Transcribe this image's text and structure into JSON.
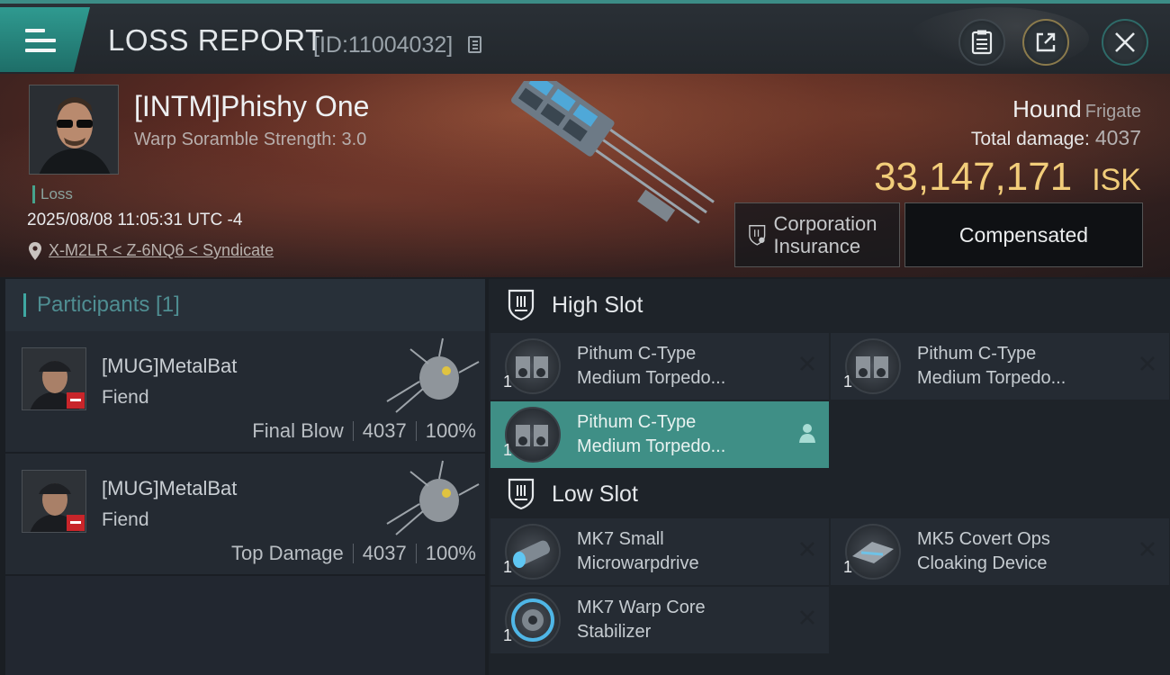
{
  "header": {
    "title": "LOSS REPORT",
    "report_id": "[ID:11004032]"
  },
  "victim": {
    "name": "[INTM]Phishy One",
    "warp_scramble": "Warp Soramble Strength: 3.0",
    "status": "Loss",
    "timestamp": "2025/08/08 11:05:31 UTC -4",
    "location": "X-M2LR < Z-6NQ6 < Syndicate"
  },
  "ship": {
    "name": "Hound",
    "class": "Frigate",
    "total_damage_label": "Total damage:",
    "total_damage": "4037",
    "isk_value": "33,147,171",
    "isk_unit": "ISK",
    "insurance_label": "Corporation Insurance",
    "compensation_status": "Compensated"
  },
  "participants": {
    "header": "Participants [1]",
    "rows": [
      {
        "name": "[MUG]MetalBat",
        "ship": "Fiend",
        "role": "Final Blow",
        "damage": "4037",
        "percent": "100%"
      },
      {
        "name": "[MUG]MetalBat",
        "ship": "Fiend",
        "role": "Top Damage",
        "damage": "4037",
        "percent": "100%"
      }
    ]
  },
  "fittings": {
    "high_slot_label": "High Slot",
    "low_slot_label": "Low Slot",
    "high_items": [
      {
        "name_line1": "Pithum C-Type",
        "name_line2": "Medium Torpedo...",
        "qty": "1",
        "state": "destroyed"
      },
      {
        "name_line1": "Pithum C-Type",
        "name_line2": "Medium Torpedo...",
        "qty": "1",
        "state": "destroyed"
      },
      {
        "name_line1": "Pithum C-Type",
        "name_line2": "Medium Torpedo...",
        "qty": "1",
        "state": "dropped"
      }
    ],
    "low_items": [
      {
        "name_line1": "MK7 Small",
        "name_line2": "Microwarpdrive",
        "qty": "1",
        "state": "destroyed"
      },
      {
        "name_line1": "MK5 Covert Ops",
        "name_line2": "Cloaking Device",
        "qty": "1",
        "state": "destroyed"
      },
      {
        "name_line1": "MK7 Warp Core",
        "name_line2": "Stabilizer",
        "qty": "1",
        "state": "destroyed"
      }
    ]
  },
  "colors": {
    "accent_teal": "#3f8f86",
    "isk_gold": "#f2cd7a",
    "loss_green": "#46a38c"
  }
}
